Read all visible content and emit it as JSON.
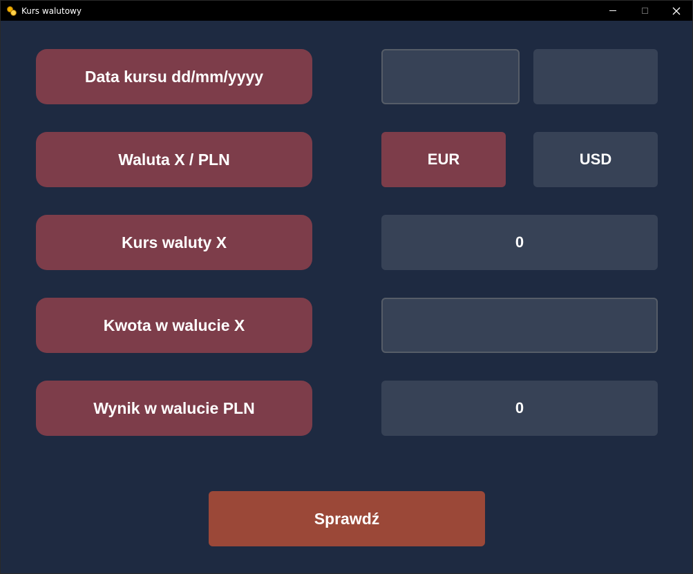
{
  "window": {
    "title": "Kurs walutowy"
  },
  "labels": {
    "date": "Data kursu dd/mm/yyyy",
    "currency": "Waluta X / PLN",
    "rate": "Kurs waluty X",
    "amount": "Kwota w walucie X",
    "result": "Wynik w walucie PLN"
  },
  "currency_buttons": {
    "eur": "EUR",
    "usd": "USD",
    "selected": "EUR"
  },
  "values": {
    "rate": "0",
    "result": "0",
    "date_input_1": "",
    "date_input_2": "",
    "amount_input": ""
  },
  "submit_label": "Sprawdź",
  "colors": {
    "background": "#1e2a41",
    "label": "#7d3d4a",
    "field": "#374256",
    "submit": "#9b4838"
  }
}
